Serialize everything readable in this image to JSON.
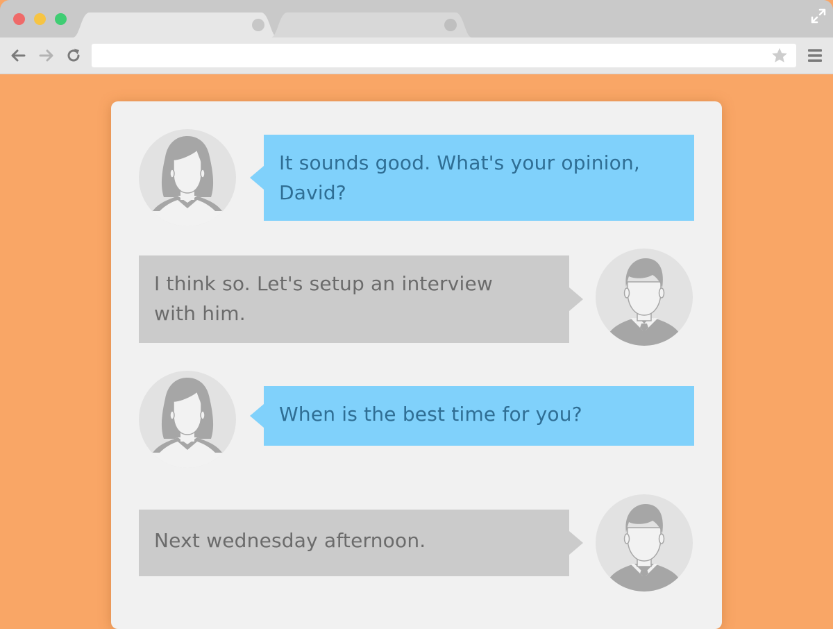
{
  "browser": {
    "tabs": [
      {
        "close_icon": "tab-close-dot"
      },
      {
        "close_icon": "tab-close-dot"
      }
    ],
    "toolbar": {
      "back_icon": "arrow-left-icon",
      "forward_icon": "arrow-right-icon",
      "reload_icon": "reload-icon",
      "address_value": "",
      "bookmark_icon": "star-icon",
      "menu_icon": "hamburger-menu-icon"
    },
    "window_controls": [
      "close",
      "minimize",
      "maximize"
    ],
    "expand_icon": "fullscreen-expand-icon"
  },
  "colors": {
    "page_background": "#f9a666",
    "incoming_bubble": "#80d1fb",
    "incoming_text": "#2f6e94",
    "outgoing_bubble": "#cbcbcb",
    "outgoing_text": "#6b6b6b"
  },
  "chat": {
    "messages": [
      {
        "sender_avatar": "woman-avatar-icon",
        "text_line_1": "It sounds good. What's your opinion,",
        "text_line_2": "David?"
      },
      {
        "sender_avatar": "man-avatar-icon",
        "text_line_1": "I think so. Let's setup an interview",
        "text_line_2": "with him."
      },
      {
        "sender_avatar": "woman-avatar-icon",
        "text_line_1": "When is the best time for you?"
      },
      {
        "sender_avatar": "man-avatar-icon",
        "text_line_1": "Next wednesday afternoon."
      }
    ]
  }
}
